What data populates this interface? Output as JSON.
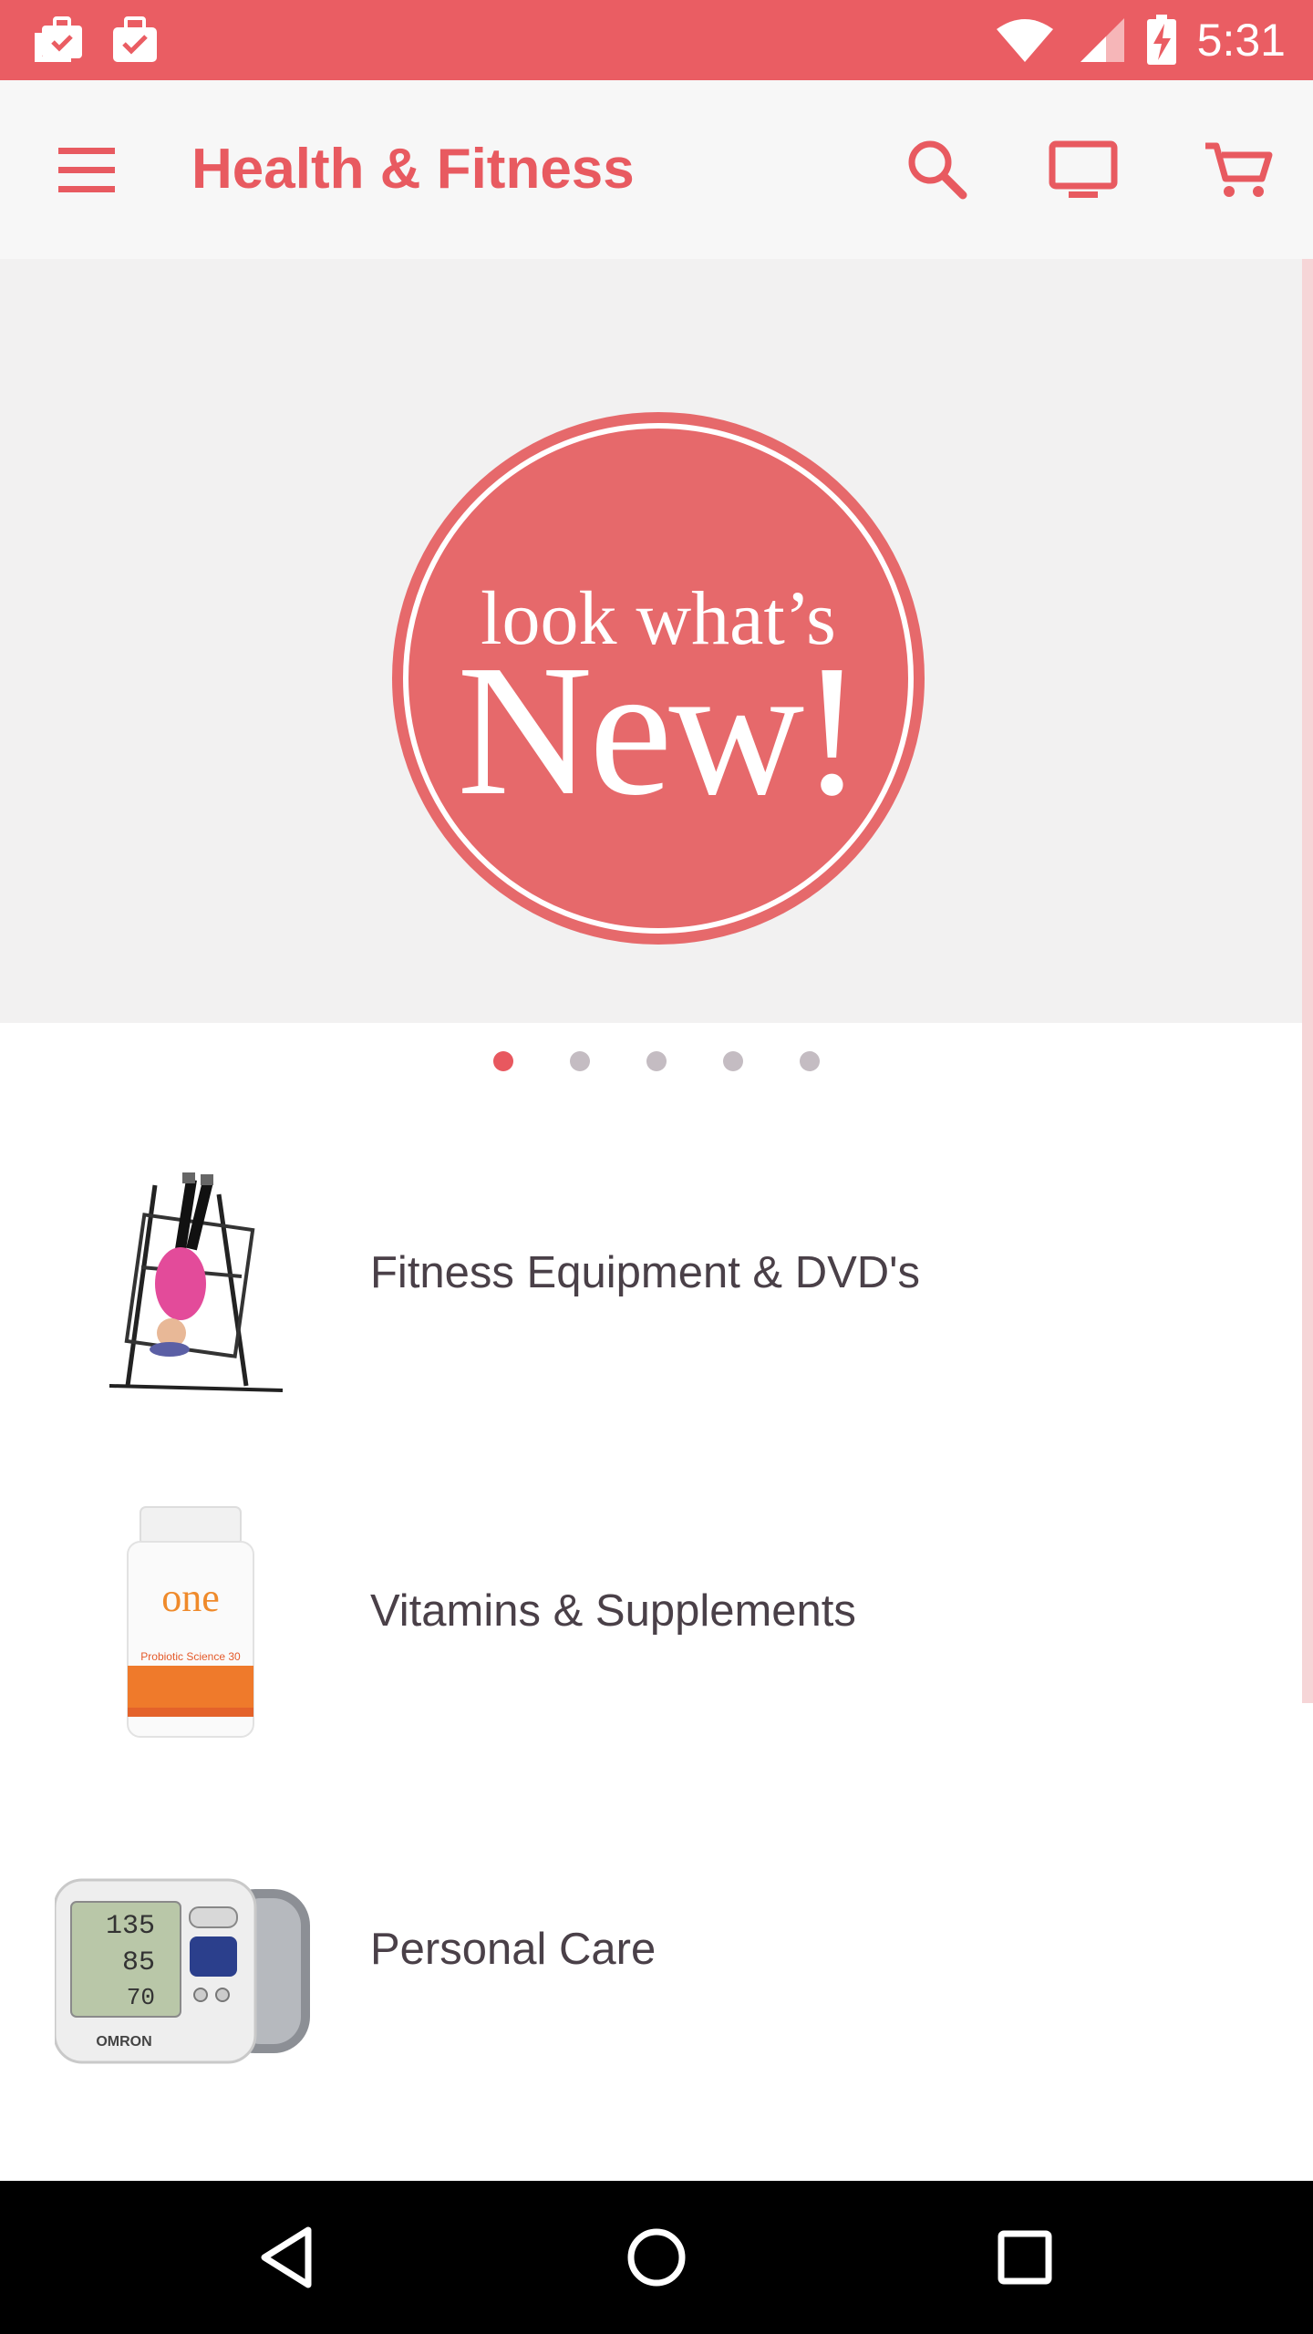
{
  "status_bar": {
    "time": "5:31",
    "background_color": "#ea5d63",
    "icons": [
      "briefcase-check-icon",
      "briefcase-check-icon",
      "wifi-icon",
      "signal-icon",
      "battery-charging-icon"
    ]
  },
  "app_bar": {
    "title": "Health & Fitness",
    "accent_color": "#e85a60",
    "icons": [
      "menu-icon",
      "search-icon",
      "tv-icon",
      "cart-icon"
    ]
  },
  "banner": {
    "line1": "look what’s",
    "line2": "New!",
    "circle_color": "#e6696b"
  },
  "carousel": {
    "page_count": 5,
    "active_index": 0
  },
  "categories": [
    {
      "label": "Fitness Equipment & DVD's",
      "icon": "inversion-table-image"
    },
    {
      "label": "Vitamins & Supplements",
      "icon": "supplement-bottle-image"
    },
    {
      "label": "Personal Care",
      "icon": "blood-pressure-monitor-image"
    }
  ],
  "bottom_images_text": {
    "bottle_brand": "one",
    "bottle_product": "Probiotic Science 30",
    "monitor_brand": "OMRON",
    "monitor_readings": [
      "135",
      "85",
      "70"
    ]
  },
  "nav_bar": {
    "icons": [
      "back-icon",
      "home-icon",
      "recents-icon"
    ]
  }
}
